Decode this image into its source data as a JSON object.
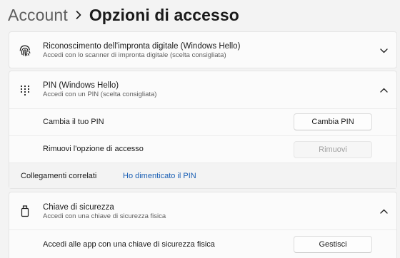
{
  "breadcrumb": {
    "parent": "Account",
    "current": "Opzioni di accesso"
  },
  "fingerprint": {
    "icon": "fingerprint-icon",
    "title": "Riconoscimento dell'impronta digitale (Windows Hello)",
    "subtitle": "Accedi con lo scanner di impronta digitale (scelta consigliata)",
    "expanded": false
  },
  "pin": {
    "icon": "keypad-icon",
    "title": "PIN (Windows Hello)",
    "subtitle": "Accedi con un PIN (scelta consigliata)",
    "expanded": true,
    "change_label": "Cambia il tuo PIN",
    "change_button": "Cambia PIN",
    "remove_label": "Rimuovi l'opzione di accesso",
    "remove_button": "Rimuovi",
    "related_label": "Collegamenti correlati",
    "related_link": "Ho dimenticato il PIN"
  },
  "security_key": {
    "icon": "usb-key-icon",
    "title": "Chiave di sicurezza",
    "subtitle": "Accedi con una chiave di sicurezza fisica",
    "expanded": true,
    "manage_label": "Accedi alle app con una chiave di sicurezza fisica",
    "manage_button": "Gestisci"
  },
  "colors": {
    "background": "#f3f3f3",
    "card": "#fbfbfb",
    "link": "#1a5fb4"
  }
}
